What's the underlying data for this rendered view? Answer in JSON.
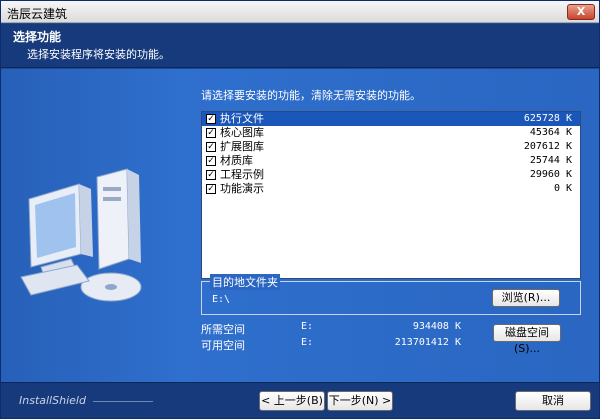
{
  "window": {
    "title": "浩辰云建筑",
    "close_label": "X"
  },
  "header": {
    "title": "选择功能",
    "subtitle": "选择安装程序将安装的功能。"
  },
  "main": {
    "instruction": "请选择要安装的功能，清除无需安装的功能。",
    "features": [
      {
        "label": "执行文件",
        "size": "625728 K",
        "checked": true,
        "selected": true
      },
      {
        "label": "核心图库",
        "size": "45364 K",
        "checked": true,
        "selected": false
      },
      {
        "label": "扩展图库",
        "size": "207612 K",
        "checked": true,
        "selected": false
      },
      {
        "label": "材质库",
        "size": "25744 K",
        "checked": true,
        "selected": false
      },
      {
        "label": "工程示例",
        "size": "29960 K",
        "checked": true,
        "selected": false
      },
      {
        "label": "功能演示",
        "size": "0 K",
        "checked": true,
        "selected": false
      }
    ],
    "destination": {
      "legend": "目的地文件夹",
      "path": "E:\\",
      "browse_label": "浏览(R)..."
    },
    "space": {
      "required": {
        "label": "所需空间",
        "drive": "E:",
        "value": "934408 K"
      },
      "available": {
        "label": "可用空间",
        "drive": "E:",
        "value": "213701412 K"
      }
    },
    "disk_space_label": "磁盘空间(S)..."
  },
  "footer": {
    "brand": "InstallShield",
    "back_label": "< 上一步(B)",
    "next_label": "下一步(N) >",
    "cancel_label": "取消"
  },
  "colors": {
    "header": "#163a7c",
    "body": "#2a66c2",
    "selection": "#1b56b9"
  }
}
